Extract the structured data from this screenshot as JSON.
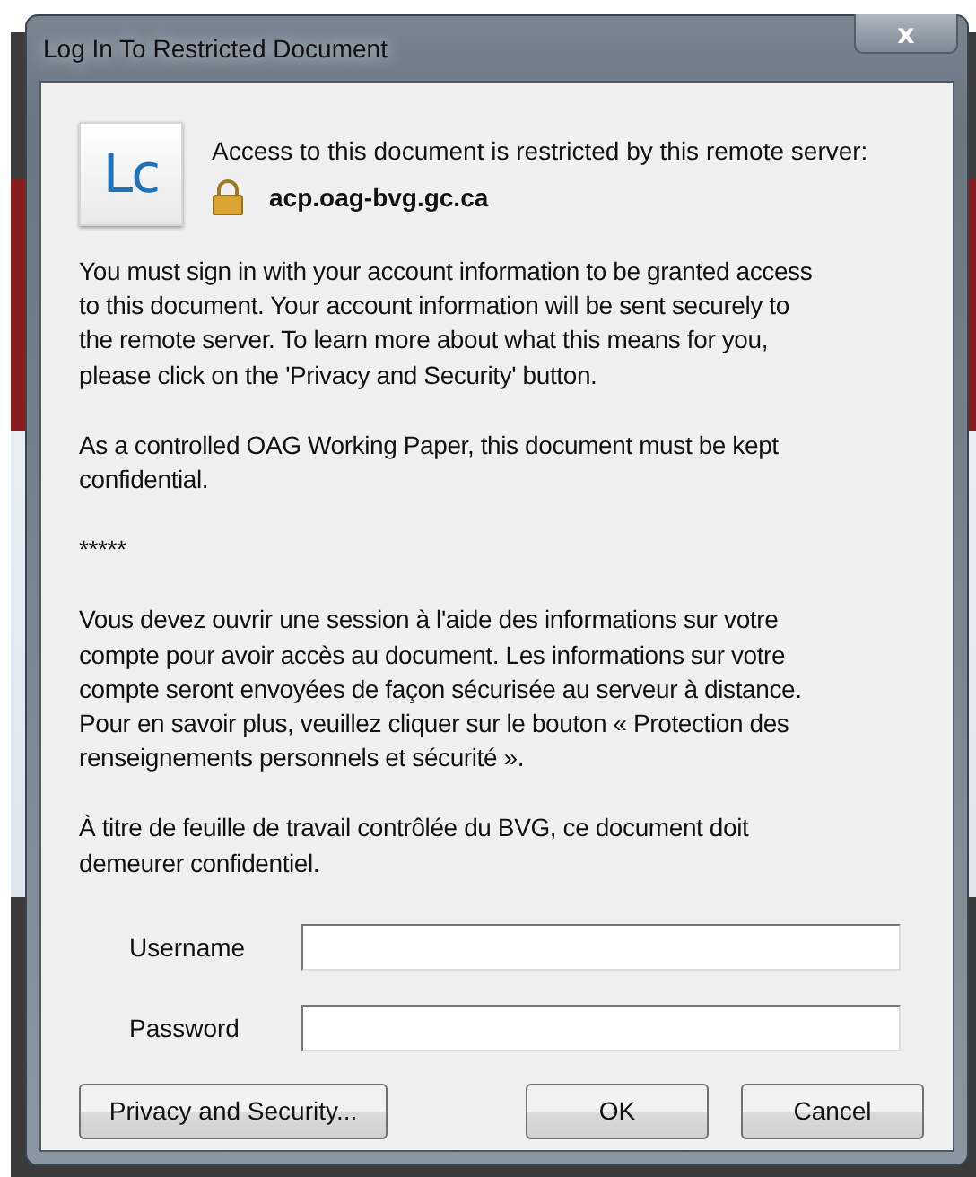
{
  "window": {
    "title": "Log In To Restricted Document",
    "close_label": "x"
  },
  "header": {
    "message": "Access to this document is restricted by this remote server:",
    "server": "acp.oag-bvg.gc.ca"
  },
  "paragraphs": [
    "You must sign in with your account information to be granted access\nto this document. Your account information will be sent securely to\nthe remote server. To learn more about what this means for you,\nplease click on the 'Privacy and Security' button.",
    "As a controlled OAG Working Paper, this document must be kept\nconfidential.",
    "*****",
    "Vous devez ouvrir une session à l'aide des informations sur votre\ncompte pour avoir accès au document. Les informations sur votre\ncompte seront envoyées de façon sécurisée au serveur à distance.\nPour en savoir plus, veuillez cliquer sur le bouton « Protection des\nrenseignements personnels et sécurité ».",
    "À titre de feuille de travail contrôlée du BVG, ce document doit\ndemeurer confidentiel."
  ],
  "logo_text": "Lc",
  "fields": [
    {
      "label": "Username"
    },
    {
      "label": "Password"
    }
  ],
  "buttons": {
    "left": "Privacy and Security...",
    "ok": "OK",
    "cancel": "Cancel"
  }
}
